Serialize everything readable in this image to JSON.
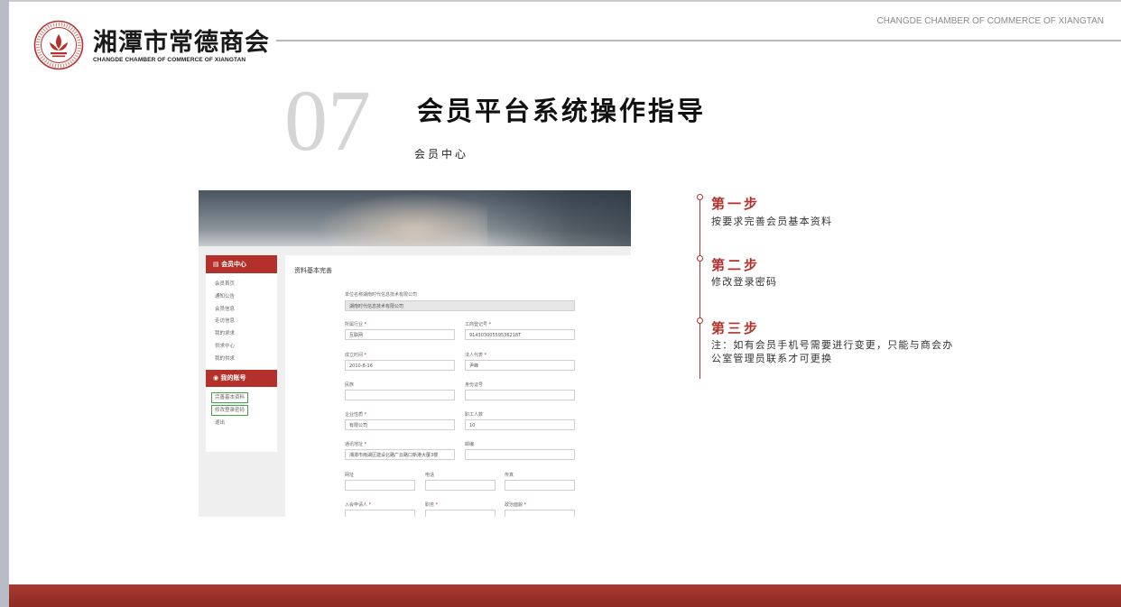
{
  "header": {
    "logo_name": "湘潭市常德商会",
    "logo_en": "CHANGDE CHAMBER OF COMMERCE OF XIANGTAN",
    "corner_en": "CHANGDE CHAMBER OF COMMERCE OF XIANGTAN"
  },
  "section": {
    "number": "07",
    "title": "会员平台系统操作指导",
    "subtitle": "会员中心"
  },
  "screenshot": {
    "sidebar": {
      "heading_center": "会员中心",
      "items": [
        "会员首页",
        "通知公告",
        "会员信息",
        "走访信息",
        "我的求求",
        "供求中心",
        "我的供求"
      ],
      "heading_account": "我的账号",
      "account_items": [
        "完善基本资料",
        "修改登录密码",
        "退出"
      ]
    },
    "content": {
      "title": "资料基本完善",
      "fields": {
        "company_label": "单位名称湖南时代信息技术有限公司",
        "company_value": "湖南时代信息技术有限公司",
        "industry_label": "所属行业",
        "industry_value": "互联网",
        "reg_label": "工商登记号",
        "reg_value": "91430300559536218T",
        "founded_label": "成立时间",
        "founded_value": "2010-8-16",
        "legal_label": "法人代表",
        "legal_value": "尹峰",
        "nation_label": "民族",
        "idcard_label": "身份证号",
        "nature_label": "企业性质",
        "nature_value": "有限公司",
        "staff_label": "职工人数",
        "staff_value": "10",
        "address_label": "通讯地址",
        "address_value": "湘潭市雨湖区建设北路广云路口新港大厦3楼",
        "zip_label": "邮编",
        "web_label": "网址",
        "phone_label": "电话",
        "fax_label": "传真",
        "introducer_label": "入会申请人",
        "post_label": "职务",
        "politics_label": "政治面貌"
      }
    }
  },
  "steps": [
    {
      "title": "第一步",
      "desc": "按要求完善会员基本资料"
    },
    {
      "title": "第二步",
      "desc": "修改登录密码"
    },
    {
      "title": "第三步",
      "desc": "注：如有会员手机号需要进行变更，只能与商会办公室管理员联系才可更换"
    }
  ],
  "colors": {
    "accent": "#b3312a",
    "highlight_box": "#3fa640",
    "footer": "#9a2f29"
  }
}
